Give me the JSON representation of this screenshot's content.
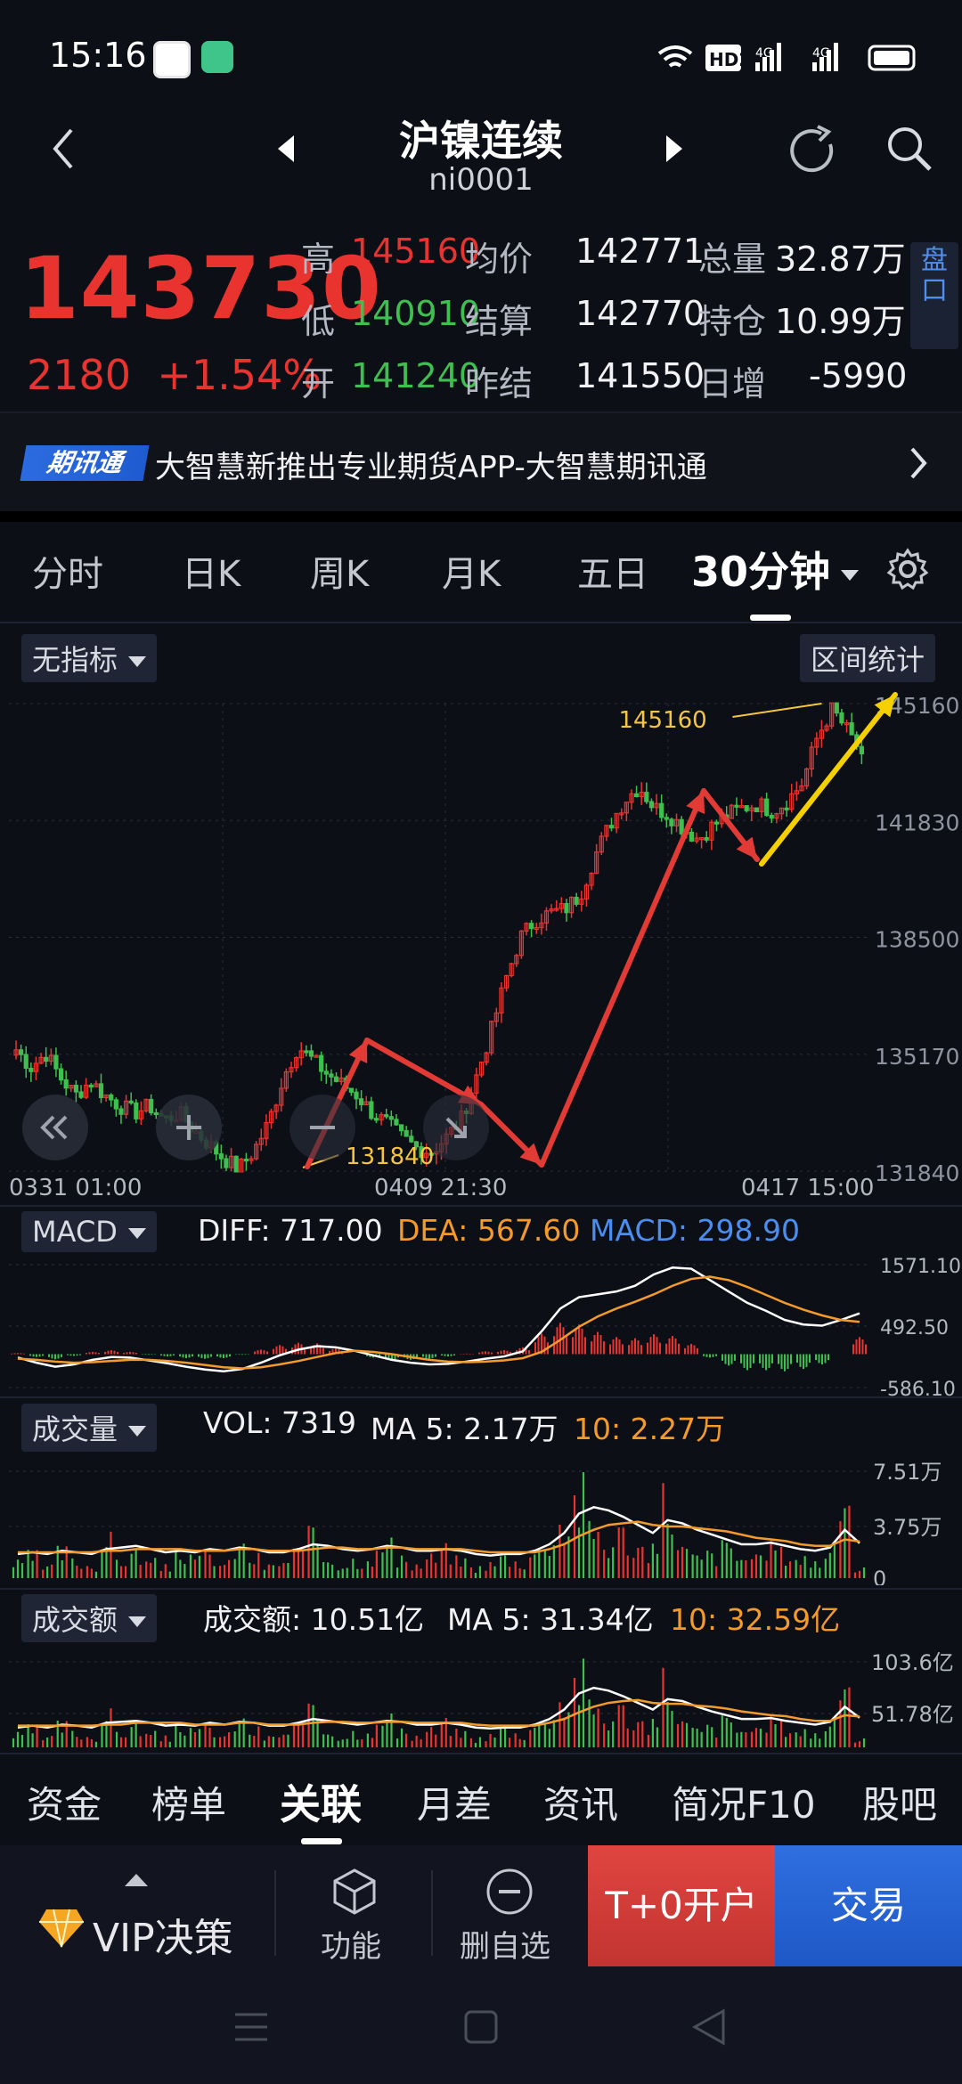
{
  "status": {
    "time": "15:16",
    "hd": "HD2",
    "net1": "4G",
    "net2": "4G"
  },
  "header": {
    "title": "沪镍连续",
    "code": "ni0001"
  },
  "quote": {
    "price": "143730",
    "change": "2180",
    "change_pct": "+1.54%",
    "high_label": "高",
    "high": "145160",
    "avg_label": "均价",
    "avg": "142771",
    "vol_label": "总量",
    "vol": "32.87万",
    "low_label": "低",
    "low": "140910",
    "settle_label": "结算",
    "settle": "142770",
    "oi_label": "持仓",
    "oi": "10.99万",
    "open_label": "开",
    "open": "141240",
    "prev_label": "昨结",
    "prev": "141550",
    "daily_label": "日增",
    "daily": "-5990",
    "pankou": "盘口"
  },
  "banner": {
    "badge": "期讯通",
    "text": "大智慧新推出专业期货APP-大智慧期讯通"
  },
  "tabs": [
    "分时",
    "日K",
    "周K",
    "月K",
    "五日",
    "30分钟"
  ],
  "indicator_chip": "无指标",
  "range_stats": "区间统计",
  "macd": {
    "chip": "MACD",
    "diff": "DIFF: 717.00",
    "dea": "DEA: 567.60",
    "macd": "MACD: 298.90"
  },
  "volume": {
    "chip": "成交量",
    "vol": "VOL: 7319",
    "ma5": "MA 5: 2.17万",
    "ma10": "10: 2.27万"
  },
  "amount": {
    "chip": "成交额",
    "amt": "成交额: 10.51亿",
    "ma5": "MA 5: 31.34亿",
    "ma10": "10: 32.59亿"
  },
  "bottom_tabs": [
    "资金",
    "榜单",
    "关联",
    "月差",
    "资讯",
    "简况F10",
    "股吧"
  ],
  "bottom_bar": {
    "vip": "VIP决策",
    "func": "功能",
    "del": "删自选",
    "t0": "T+0开户",
    "trade": "交易"
  },
  "colors": {
    "up": "#e8332f",
    "down": "#3fbf4f",
    "accent": "#2b6be0",
    "yellow": "#f5d000",
    "orange": "#f39a2d",
    "macd_blue": "#4a8ff0"
  },
  "chart_data": [
    {
      "type": "candlestick",
      "title": "30分钟",
      "y_ticks": [
        "145160",
        "141830",
        "138500",
        "135170",
        "131840"
      ],
      "ylim": [
        131840,
        145160
      ],
      "x_labels": [
        "0331 01:00",
        "0409 21:30",
        "0417 15:00"
      ],
      "annotations": {
        "max": "145160",
        "min": "131840"
      },
      "close_path": [
        135300,
        134800,
        135200,
        134500,
        134000,
        134400,
        134000,
        133700,
        133500,
        133700,
        133300,
        133500,
        133000,
        132600,
        132200,
        131900,
        132400,
        133200,
        134500,
        135400,
        135000,
        134600,
        134300,
        134000,
        133500,
        133200,
        132800,
        132500,
        132400,
        132800,
        133300,
        134500,
        135800,
        137300,
        138500,
        139000,
        139200,
        139300,
        139700,
        140800,
        141700,
        142400,
        142800,
        142200,
        142000,
        141600,
        141300,
        141700,
        142000,
        142200,
        142300,
        142100,
        142400,
        142900,
        144200,
        145000,
        144400,
        143730
      ]
    },
    {
      "type": "line",
      "title": "MACD",
      "y_ticks": [
        "1571.10",
        "492.50",
        "-586.10"
      ],
      "ylim": [
        -586.1,
        1571.1
      ],
      "series": [
        {
          "name": "DIFF",
          "values": [
            -60,
            -150,
            -220,
            -180,
            -100,
            -50,
            -60,
            -110,
            -160,
            -220,
            -270,
            -300,
            -260,
            -150,
            -20,
            80,
            140,
            120,
            60,
            -20,
            -100,
            -150,
            -180,
            -170,
            -130,
            -80,
            -40,
            50,
            400,
            800,
            1000,
            1050,
            1100,
            1200,
            1400,
            1520,
            1500,
            1300,
            1100,
            900,
            760,
            600,
            520,
            500,
            600,
            717
          ]
        },
        {
          "name": "DEA",
          "values": [
            -80,
            -100,
            -130,
            -150,
            -140,
            -120,
            -100,
            -100,
            -120,
            -150,
            -190,
            -230,
            -250,
            -230,
            -180,
            -120,
            -50,
            20,
            60,
            40,
            0,
            -50,
            -100,
            -130,
            -140,
            -130,
            -110,
            -70,
            40,
            250,
            480,
            660,
            800,
            920,
            1050,
            1200,
            1320,
            1360,
            1300,
            1180,
            1040,
            900,
            780,
            680,
            600,
            567.6
          ]
        }
      ],
      "bars": [
        20,
        -50,
        -90,
        -30,
        40,
        70,
        40,
        -10,
        -40,
        -70,
        -80,
        -70,
        -10,
        80,
        160,
        200,
        190,
        100,
        0,
        -60,
        -100,
        -100,
        -80,
        -40,
        10,
        50,
        70,
        120,
        360,
        550,
        520,
        390,
        300,
        280,
        350,
        320,
        180,
        -60,
        -200,
        -280,
        -280,
        -300,
        -260,
        -180,
        0,
        298.9
      ]
    },
    {
      "type": "bar",
      "title": "成交量",
      "y_ticks": [
        "7.51万",
        "3.75万",
        "0"
      ],
      "ylim": [
        0,
        75100
      ],
      "bars": [
        12000,
        18000,
        9000,
        22000,
        14000,
        11000,
        30000,
        16000,
        21000,
        13000,
        9000,
        24000,
        15000,
        19000,
        12000,
        26000,
        17000,
        10000,
        14000,
        22000,
        33000,
        18000,
        12000,
        16000,
        20000,
        28000,
        14000,
        11000,
        17000,
        23000,
        15000,
        9000,
        12000,
        18000,
        14000,
        22000,
        36000,
        48000,
        70000,
        42000,
        30000,
        38000,
        26000,
        22000,
        68000,
        24000,
        17000,
        20000,
        26000,
        18000,
        15000,
        28000,
        21000,
        17000,
        14000,
        22000,
        73000,
        7319
      ],
      "series": [
        {
          "name": "MA 5",
          "values": [
            15000,
            16000,
            15000,
            17000,
            16000,
            15000,
            18000,
            19000,
            20000,
            18000,
            16000,
            17000,
            16000,
            18000,
            17000,
            19000,
            18000,
            16000,
            16000,
            18000,
            21000,
            20000,
            18000,
            17000,
            18000,
            20000,
            19000,
            17000,
            17000,
            18000,
            17000,
            15000,
            14000,
            15000,
            15000,
            17000,
            21000,
            28000,
            40000,
            44000,
            42000,
            38000,
            33000,
            28000,
            36000,
            34000,
            30000,
            27000,
            24000,
            21000,
            21000,
            22000,
            20000,
            18000,
            17000,
            19000,
            30000,
            21700
          ]
        },
        {
          "name": "10",
          "values": [
            16000,
            16000,
            16000,
            16000,
            16000,
            16000,
            17000,
            17000,
            18000,
            18000,
            18000,
            18000,
            17000,
            17000,
            17000,
            18000,
            18000,
            17000,
            17000,
            17000,
            18000,
            19000,
            19000,
            18000,
            18000,
            19000,
            19000,
            18000,
            18000,
            18000,
            18000,
            17000,
            16000,
            16000,
            16000,
            16000,
            18000,
            21000,
            26000,
            30000,
            33000,
            34000,
            35000,
            33000,
            32000,
            32000,
            31000,
            30000,
            29000,
            27000,
            25000,
            24000,
            23000,
            21000,
            20000,
            20000,
            24000,
            22700
          ]
        }
      ]
    },
    {
      "type": "bar",
      "title": "成交额",
      "y_ticks": [
        "103.6亿",
        "51.78亿"
      ],
      "ylim": [
        0,
        103.6
      ],
      "bars": [
        17,
        25,
        13,
        31,
        20,
        16,
        43,
        23,
        30,
        18,
        13,
        34,
        21,
        27,
        17,
        37,
        24,
        14,
        20,
        31,
        47,
        25,
        17,
        23,
        28,
        40,
        20,
        16,
        24,
        33,
        21,
        13,
        17,
        26,
        20,
        31,
        51,
        69,
        100,
        60,
        43,
        54,
        37,
        31,
        97,
        34,
        24,
        28,
        37,
        26,
        21,
        40,
        30,
        24,
        20,
        31,
        103,
        10.51
      ],
      "series": [
        {
          "name": "MA 5",
          "values": [
            21,
            23,
            21,
            24,
            23,
            21,
            26,
            27,
            28,
            26,
            23,
            24,
            23,
            26,
            24,
            27,
            26,
            23,
            23,
            26,
            30,
            28,
            26,
            24,
            26,
            28,
            27,
            24,
            24,
            26,
            24,
            21,
            20,
            21,
            21,
            24,
            30,
            40,
            57,
            63,
            60,
            54,
            47,
            40,
            51,
            49,
            43,
            38,
            34,
            30,
            30,
            31,
            28,
            26,
            24,
            27,
            43,
            31.34
          ]
        },
        {
          "name": "10",
          "values": [
            23,
            23,
            23,
            23,
            23,
            23,
            24,
            24,
            26,
            26,
            26,
            26,
            24,
            24,
            24,
            26,
            26,
            24,
            24,
            24,
            26,
            27,
            27,
            26,
            26,
            27,
            27,
            26,
            26,
            26,
            26,
            24,
            23,
            23,
            23,
            23,
            26,
            30,
            37,
            43,
            47,
            49,
            50,
            47,
            46,
            46,
            44,
            43,
            41,
            38,
            36,
            34,
            33,
            30,
            28,
            28,
            34,
            32.59
          ]
        }
      ]
    }
  ]
}
